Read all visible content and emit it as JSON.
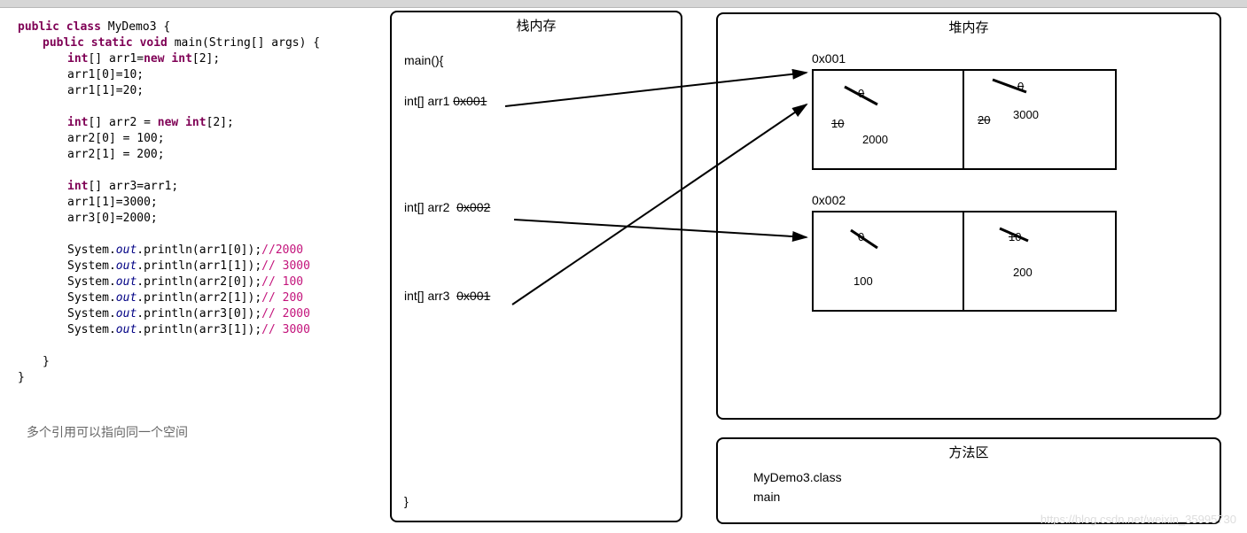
{
  "code": {
    "classDecl": {
      "pre": "public class ",
      "name": "MyDemo3",
      "post": " {"
    },
    "mainDecl": {
      "pre": "public static void",
      "name": " main(String[] args) {"
    },
    "l3": {
      "t": "int",
      "r": "[] arr1=",
      "k": "new int",
      "r2": "[2];"
    },
    "l4": "arr1[0]=10;",
    "l5": "arr1[1]=20;",
    "l6": {
      "t": "int",
      "r": "[] arr2 = ",
      "k": "new int",
      "r2": "[2];"
    },
    "l7": "arr2[0] = 100;",
    "l8": "arr2[1] = 200;",
    "l9": {
      "t": "int",
      "r": "[] arr3=arr1;"
    },
    "l10": "arr1[1]=3000;",
    "l11": "arr3[0]=2000;",
    "p1": {
      "pre": "System.",
      "o": "out",
      "post": ".println(arr1[0]);",
      "c": "//2000"
    },
    "p2": {
      "pre": "System.",
      "o": "out",
      "post": ".println(arr1[1]);",
      "c": "// 3000"
    },
    "p3": {
      "pre": "System.",
      "o": "out",
      "post": ".println(arr2[0]);",
      "c": "// 100"
    },
    "p4": {
      "pre": "System.",
      "o": "out",
      "post": ".println(arr2[1]);",
      "c": "// 200"
    },
    "p5": {
      "pre": "System.",
      "o": "out",
      "post": ".println(arr3[0]);",
      "c": "// 2000"
    },
    "p6": {
      "pre": "System.",
      "o": "out",
      "post": ".println(arr3[1]);",
      "c": "// 3000"
    },
    "close1": "}",
    "close2": "}"
  },
  "note": "多个引用可以指向同一个空间",
  "stack": {
    "title": "栈内存",
    "main": "main(){",
    "arr1": {
      "l": "int[] arr1",
      "a": "0x001",
      "strike": true
    },
    "arr2": {
      "l": "int[] arr2",
      "a": "0x002",
      "strike": true
    },
    "arr3": {
      "l": "int[] arr3",
      "a": "0x001",
      "strike": true
    },
    "close": "}"
  },
  "heap": {
    "title": "堆内存",
    "a1": {
      "addr": "0x001",
      "cells": [
        {
          "old1": "0",
          "old2": "10",
          "val": "2000"
        },
        {
          "old1": "0",
          "old2": "20",
          "val": "3000"
        }
      ]
    },
    "a2": {
      "addr": "0x002",
      "cells": [
        {
          "old1": "0",
          "val": "100"
        },
        {
          "old1": "10",
          "val": "200"
        }
      ]
    }
  },
  "method": {
    "title": "方法区",
    "l1": "MyDemo3.class",
    "l2": "main"
  },
  "watermark": "https://blog.csdn.net/weixin_35995730"
}
